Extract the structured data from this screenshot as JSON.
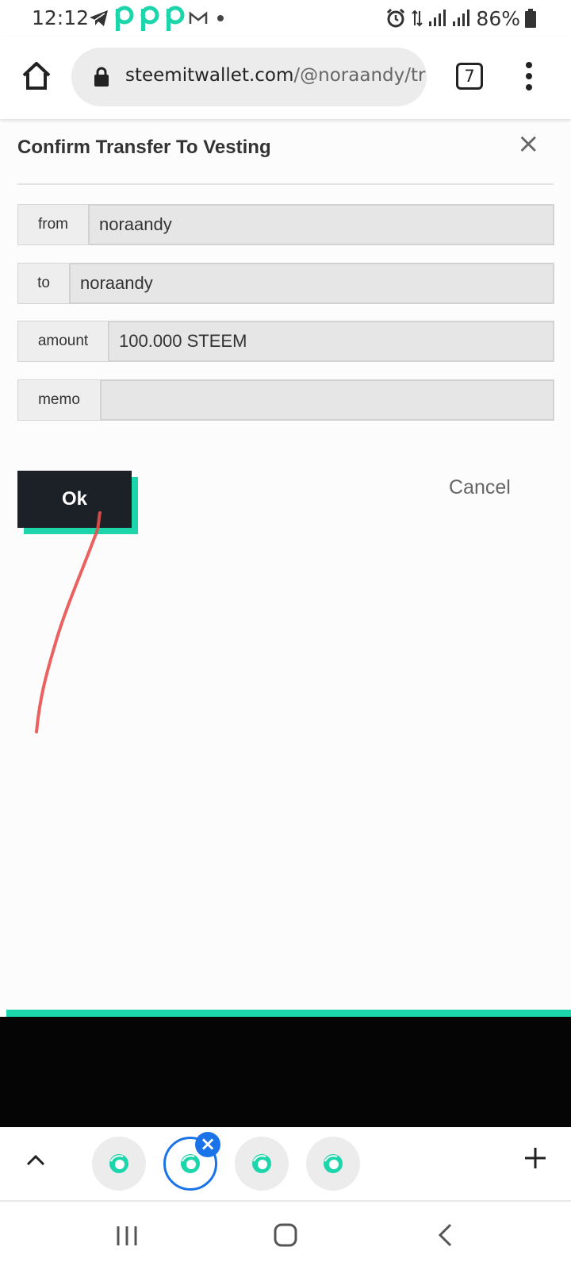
{
  "status_bar": {
    "time": "12:12",
    "battery": "86%"
  },
  "browser": {
    "url_domain": "steemitwallet.com",
    "url_path": "/@noraandy/tra",
    "tab_count": "7"
  },
  "dialog": {
    "title": "Confirm Transfer To Vesting",
    "close_label": "×",
    "fields": [
      {
        "label": "from",
        "value": "noraandy"
      },
      {
        "label": "to",
        "value": "noraandy"
      },
      {
        "label": "amount",
        "value": "100.000 STEEM"
      },
      {
        "label": "memo",
        "value": ""
      }
    ],
    "ok_label": "Ok",
    "cancel_label": "Cancel"
  },
  "colors": {
    "accent": "#1dd5ab",
    "dark_button": "#1b2126",
    "active_tab": "#1a73e8",
    "annotation": "#e8504e"
  },
  "tab_strip": {
    "close_label": "×"
  }
}
